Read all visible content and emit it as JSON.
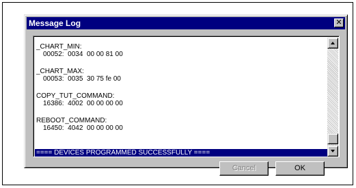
{
  "window": {
    "title": "Message Log",
    "close_glyph": "✕"
  },
  "log": {
    "entries": [
      {
        "name": "_CHART_MIN:",
        "value": "00052:  0034  00 00 81 00"
      },
      {
        "name": "_CHART_MAX:",
        "value": "00053:  0035  30 75 fe 00"
      },
      {
        "name": "COPY_TUT_COMMAND:",
        "value": "16386:  4002  00 00 00 00"
      },
      {
        "name": "REBOOT_COMMAND:",
        "value": "16450:  4042  00 00 00 00"
      }
    ],
    "selected_line": "==== DEVICES PROGRAMMED SUCCESSFULLY ===="
  },
  "buttons": {
    "cancel_label": "Cancel",
    "ok_label": "OK"
  },
  "icons": {
    "close": "close-icon",
    "scroll_up": "arrow-up-icon",
    "scroll_down": "arrow-down-icon"
  },
  "colors": {
    "titlebar": "#000080",
    "selection": "#000080",
    "dialog_face": "#c0c0c0"
  }
}
